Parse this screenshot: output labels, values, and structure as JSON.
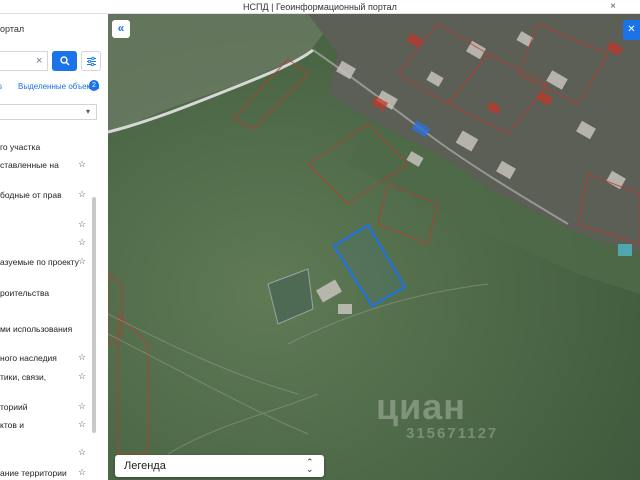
{
  "window": {
    "title": "НСПД | Геоинформационный портал",
    "close_glyph": "×"
  },
  "panel": {
    "portal_title": "ортал",
    "search": {
      "value": "",
      "placeholder": "",
      "clear_glyph": "×"
    },
    "search_icon": "search-icon",
    "filter_icon": "sliders-icon",
    "links": {
      "layers_fragment": "s",
      "selected_objects": "Выделенные объекты",
      "selected_count": "2"
    },
    "select_value": "",
    "layers": [
      {
        "label": "го участка",
        "star": false
      },
      {
        "label": "ставленные на",
        "star": true
      },
      {
        "label": "бодные от прав",
        "star": true
      },
      {
        "label": "",
        "star": true
      },
      {
        "label": "",
        "star": true
      },
      {
        "label": "азуемые по проекту",
        "star": true
      },
      {
        "label": "роительства",
        "star": false
      },
      {
        "label": "ми использования",
        "star": false
      },
      {
        "label": "ного наследия",
        "star": true
      },
      {
        "label": "тики, связи,",
        "star": true
      },
      {
        "label": "ториий",
        "star": true
      },
      {
        "label": "ктов и",
        "star": true
      },
      {
        "label": "",
        "star": true
      },
      {
        "label": "ание территории",
        "star": true
      }
    ],
    "star_glyph": "☆"
  },
  "map": {
    "collapse_glyph": "«",
    "topright_glyph": "✕",
    "legend_label": "Легенда",
    "legend_arrows": "⌃⌄",
    "watermark": "циан",
    "watermark_id": "315671127",
    "colors": {
      "parcel_highlight": "#1a73e8",
      "cadastral_lines": "#c0392b",
      "road": "#d8d8d8"
    }
  }
}
